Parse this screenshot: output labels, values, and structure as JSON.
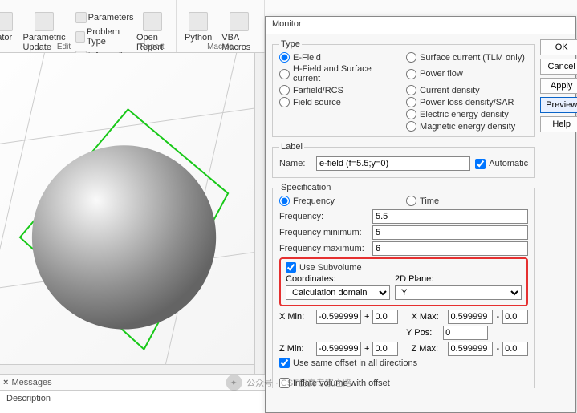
{
  "ribbon": {
    "groups": {
      "edit": "Edit",
      "report": "Report",
      "macros": "Macros"
    },
    "lator": "lator",
    "parametric_update": "Parametric Update",
    "parameters": "Parameters",
    "problem_type": "Problem Type",
    "information": "Information",
    "open_report": "Open Report",
    "python": "Python",
    "vba_macros": "VBA Macros"
  },
  "viewport": {
    "messages": "Messages",
    "description": "Description"
  },
  "dialog": {
    "title": "Monitor",
    "buttons": {
      "ok": "OK",
      "cancel": "Cancel",
      "apply": "Apply",
      "preview": "Preview",
      "help": "Help"
    },
    "type": {
      "legend": "Type",
      "efield": "E-Field",
      "hfield": "H-Field and Surface current",
      "farfield": "Farfield/RCS",
      "fieldsource": "Field source",
      "surface_current": "Surface current (TLM only)",
      "powerflow": "Power flow",
      "current_density": "Current density",
      "powerloss": "Power loss density/SAR",
      "eenergy": "Electric energy density",
      "menergy": "Magnetic energy density"
    },
    "label": {
      "legend": "Label",
      "name": "Name:",
      "name_value": "e-field (f=5.5;y=0)",
      "auto": "Automatic"
    },
    "spec": {
      "legend": "Specification",
      "freq": "Frequency",
      "time": "Time",
      "freq_label": "Frequency:",
      "freq_value": "5.5",
      "fmin_label": "Frequency minimum:",
      "fmin_value": "5",
      "fmax_label": "Frequency maximum:",
      "fmax_value": "6",
      "use_subvol": "Use Subvolume",
      "coords": "Coordinates:",
      "coords_value": "Calculation domain",
      "plane": "2D Plane:",
      "plane_value": "Y",
      "xmin": "X Min:",
      "xmin_v": "-0.599999",
      "xmin_o": "0.0",
      "xmax": "X Max:",
      "xmax_v": "0.599999",
      "xmax_o": "0.0",
      "ypos": "Y Pos:",
      "ypos_v": "0",
      "zmin": "Z Min:",
      "zmin_v": "-0.599999",
      "zmin_o": "0.0",
      "zmax": "Z Max:",
      "zmax_v": "0.599999",
      "zmax_o": "0.0",
      "same_offset": "Use same offset in all directions",
      "inflate": "Inflate volume with offset",
      "plus": "+",
      "minus": "-"
    }
  },
  "watermark": "公众号 · CST仿真专家之路"
}
